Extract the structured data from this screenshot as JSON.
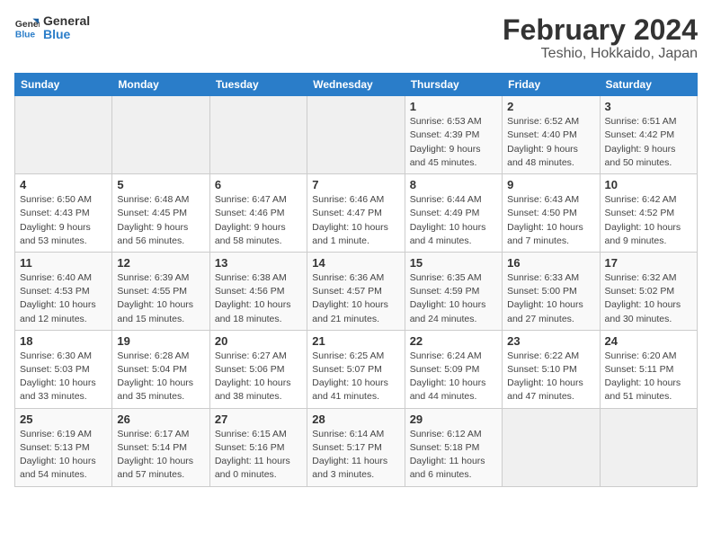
{
  "header": {
    "logo_text_general": "General",
    "logo_text_blue": "Blue",
    "month_title": "February 2024",
    "location": "Teshio, Hokkaido, Japan"
  },
  "days_of_week": [
    "Sunday",
    "Monday",
    "Tuesday",
    "Wednesday",
    "Thursday",
    "Friday",
    "Saturday"
  ],
  "weeks": [
    [
      {
        "day": "",
        "info": ""
      },
      {
        "day": "",
        "info": ""
      },
      {
        "day": "",
        "info": ""
      },
      {
        "day": "",
        "info": ""
      },
      {
        "day": "1",
        "info": "Sunrise: 6:53 AM\nSunset: 4:39 PM\nDaylight: 9 hours\nand 45 minutes."
      },
      {
        "day": "2",
        "info": "Sunrise: 6:52 AM\nSunset: 4:40 PM\nDaylight: 9 hours\nand 48 minutes."
      },
      {
        "day": "3",
        "info": "Sunrise: 6:51 AM\nSunset: 4:42 PM\nDaylight: 9 hours\nand 50 minutes."
      }
    ],
    [
      {
        "day": "4",
        "info": "Sunrise: 6:50 AM\nSunset: 4:43 PM\nDaylight: 9 hours\nand 53 minutes."
      },
      {
        "day": "5",
        "info": "Sunrise: 6:48 AM\nSunset: 4:45 PM\nDaylight: 9 hours\nand 56 minutes."
      },
      {
        "day": "6",
        "info": "Sunrise: 6:47 AM\nSunset: 4:46 PM\nDaylight: 9 hours\nand 58 minutes."
      },
      {
        "day": "7",
        "info": "Sunrise: 6:46 AM\nSunset: 4:47 PM\nDaylight: 10 hours\nand 1 minute."
      },
      {
        "day": "8",
        "info": "Sunrise: 6:44 AM\nSunset: 4:49 PM\nDaylight: 10 hours\nand 4 minutes."
      },
      {
        "day": "9",
        "info": "Sunrise: 6:43 AM\nSunset: 4:50 PM\nDaylight: 10 hours\nand 7 minutes."
      },
      {
        "day": "10",
        "info": "Sunrise: 6:42 AM\nSunset: 4:52 PM\nDaylight: 10 hours\nand 9 minutes."
      }
    ],
    [
      {
        "day": "11",
        "info": "Sunrise: 6:40 AM\nSunset: 4:53 PM\nDaylight: 10 hours\nand 12 minutes."
      },
      {
        "day": "12",
        "info": "Sunrise: 6:39 AM\nSunset: 4:55 PM\nDaylight: 10 hours\nand 15 minutes."
      },
      {
        "day": "13",
        "info": "Sunrise: 6:38 AM\nSunset: 4:56 PM\nDaylight: 10 hours\nand 18 minutes."
      },
      {
        "day": "14",
        "info": "Sunrise: 6:36 AM\nSunset: 4:57 PM\nDaylight: 10 hours\nand 21 minutes."
      },
      {
        "day": "15",
        "info": "Sunrise: 6:35 AM\nSunset: 4:59 PM\nDaylight: 10 hours\nand 24 minutes."
      },
      {
        "day": "16",
        "info": "Sunrise: 6:33 AM\nSunset: 5:00 PM\nDaylight: 10 hours\nand 27 minutes."
      },
      {
        "day": "17",
        "info": "Sunrise: 6:32 AM\nSunset: 5:02 PM\nDaylight: 10 hours\nand 30 minutes."
      }
    ],
    [
      {
        "day": "18",
        "info": "Sunrise: 6:30 AM\nSunset: 5:03 PM\nDaylight: 10 hours\nand 33 minutes."
      },
      {
        "day": "19",
        "info": "Sunrise: 6:28 AM\nSunset: 5:04 PM\nDaylight: 10 hours\nand 35 minutes."
      },
      {
        "day": "20",
        "info": "Sunrise: 6:27 AM\nSunset: 5:06 PM\nDaylight: 10 hours\nand 38 minutes."
      },
      {
        "day": "21",
        "info": "Sunrise: 6:25 AM\nSunset: 5:07 PM\nDaylight: 10 hours\nand 41 minutes."
      },
      {
        "day": "22",
        "info": "Sunrise: 6:24 AM\nSunset: 5:09 PM\nDaylight: 10 hours\nand 44 minutes."
      },
      {
        "day": "23",
        "info": "Sunrise: 6:22 AM\nSunset: 5:10 PM\nDaylight: 10 hours\nand 47 minutes."
      },
      {
        "day": "24",
        "info": "Sunrise: 6:20 AM\nSunset: 5:11 PM\nDaylight: 10 hours\nand 51 minutes."
      }
    ],
    [
      {
        "day": "25",
        "info": "Sunrise: 6:19 AM\nSunset: 5:13 PM\nDaylight: 10 hours\nand 54 minutes."
      },
      {
        "day": "26",
        "info": "Sunrise: 6:17 AM\nSunset: 5:14 PM\nDaylight: 10 hours\nand 57 minutes."
      },
      {
        "day": "27",
        "info": "Sunrise: 6:15 AM\nSunset: 5:16 PM\nDaylight: 11 hours\nand 0 minutes."
      },
      {
        "day": "28",
        "info": "Sunrise: 6:14 AM\nSunset: 5:17 PM\nDaylight: 11 hours\nand 3 minutes."
      },
      {
        "day": "29",
        "info": "Sunrise: 6:12 AM\nSunset: 5:18 PM\nDaylight: 11 hours\nand 6 minutes."
      },
      {
        "day": "",
        "info": ""
      },
      {
        "day": "",
        "info": ""
      }
    ]
  ]
}
